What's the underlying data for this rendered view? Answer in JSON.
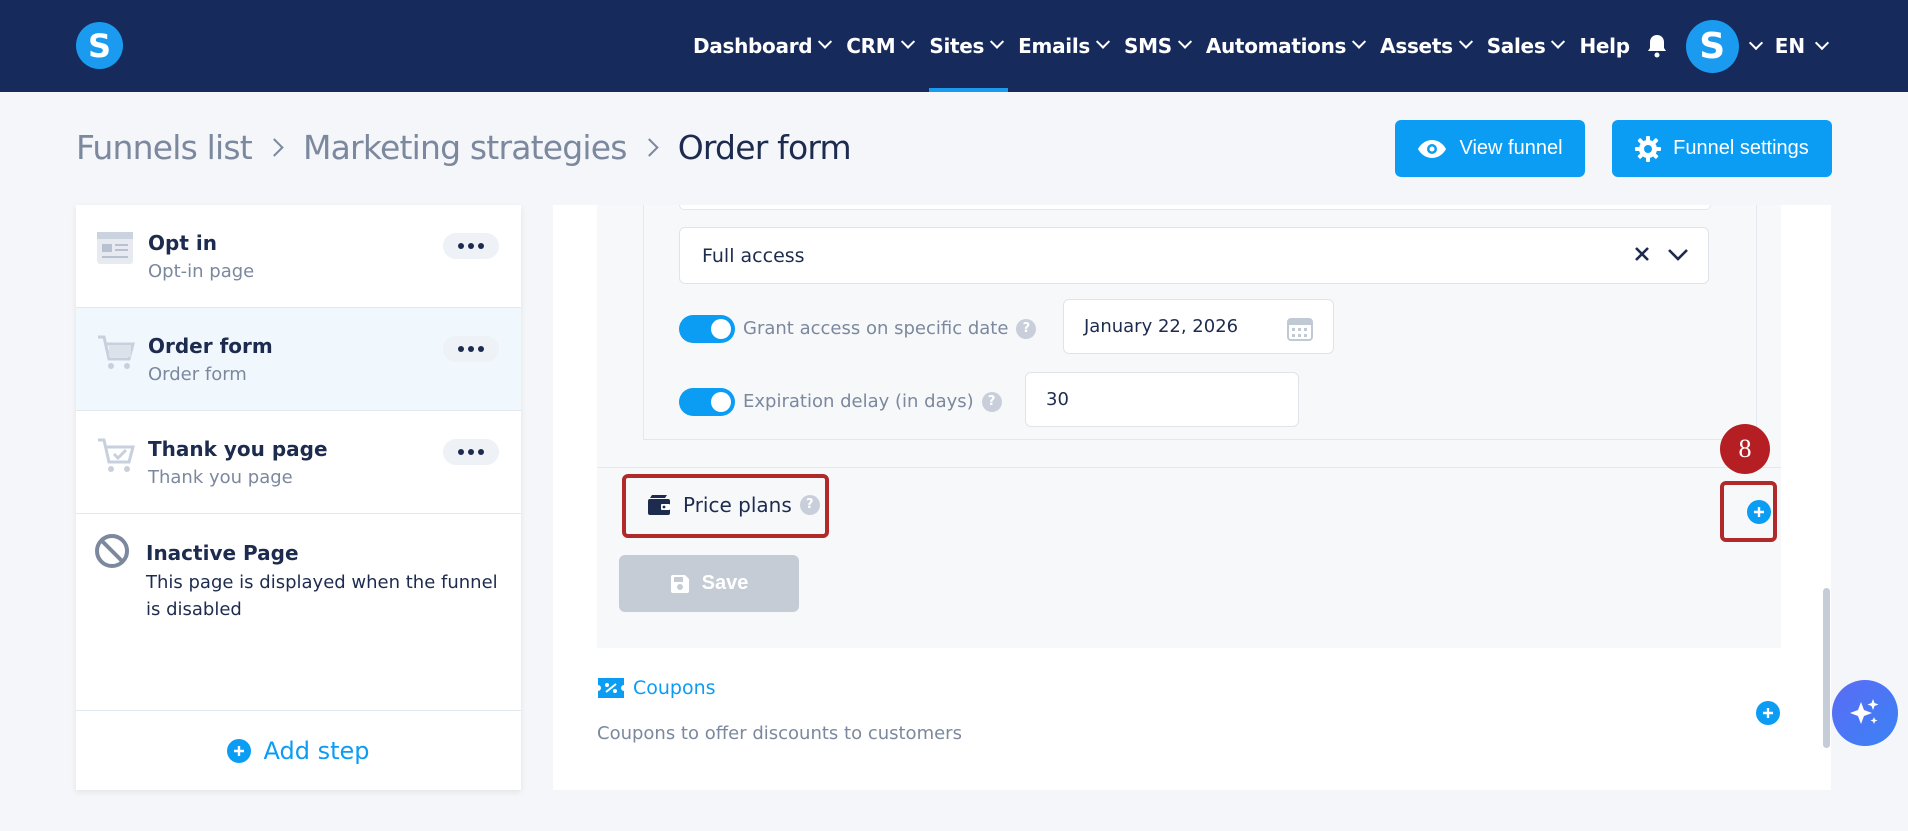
{
  "nav": {
    "items": [
      {
        "label": "Dashboard",
        "dropdown": true,
        "active": false
      },
      {
        "label": "CRM",
        "dropdown": true,
        "active": false
      },
      {
        "label": "Sites",
        "dropdown": true,
        "active": true
      },
      {
        "label": "Emails",
        "dropdown": true,
        "active": false
      },
      {
        "label": "SMS",
        "dropdown": true,
        "active": false
      },
      {
        "label": "Automations",
        "dropdown": true,
        "active": false
      },
      {
        "label": "Assets",
        "dropdown": true,
        "active": false
      },
      {
        "label": "Sales",
        "dropdown": true,
        "active": false
      },
      {
        "label": "Help",
        "dropdown": false,
        "active": false
      }
    ],
    "logo_letter": "S",
    "avatar_letter": "S",
    "language": "EN"
  },
  "breadcrumb": {
    "items": [
      "Funnels list",
      "Marketing strategies"
    ],
    "current": "Order form"
  },
  "header_buttons": {
    "view_funnel": "View funnel",
    "funnel_settings": "Funnel settings"
  },
  "steps": [
    {
      "title": "Opt in",
      "subtitle": "Opt-in page",
      "icon": "page-icon",
      "selected": false
    },
    {
      "title": "Order form",
      "subtitle": "Order form",
      "icon": "cart-icon",
      "selected": true
    },
    {
      "title": "Thank you page",
      "subtitle": "Thank you page",
      "icon": "cart-check-icon",
      "selected": false
    }
  ],
  "inactive_page": {
    "title": "Inactive Page",
    "description": "This page is displayed when the funnel is disabled"
  },
  "add_step_label": "Add step",
  "access": {
    "select_value": "Full access",
    "grant_label": "Grant access on specific date",
    "grant_enabled": true,
    "grant_date": "January 22, 2026",
    "expiration_label": "Expiration delay (in days)",
    "expiration_enabled": true,
    "expiration_value": "30"
  },
  "price_plans_label": "Price plans",
  "annotation_badge": "8",
  "save_label": "Save",
  "coupons": {
    "title": "Coupons",
    "description": "Coupons to offer discounts to customers"
  },
  "colors": {
    "topbar": "#162b5c",
    "accent": "#0b9cf4",
    "highlight": "#b02a2a"
  }
}
